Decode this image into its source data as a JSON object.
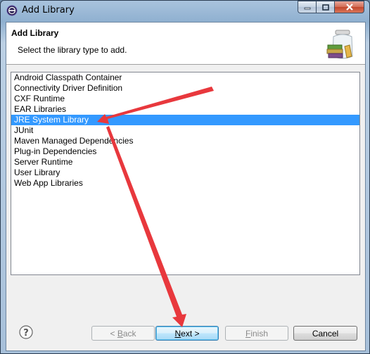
{
  "window": {
    "title": "Add Library",
    "controls": [
      "minimize",
      "maximize",
      "close"
    ]
  },
  "header": {
    "title": "Add Library",
    "description": "Select the library type to add.",
    "icon": "library-jar-icon"
  },
  "library_types": [
    {
      "label": "Android Classpath Container",
      "selected": false
    },
    {
      "label": "Connectivity Driver Definition",
      "selected": false
    },
    {
      "label": "CXF Runtime",
      "selected": false
    },
    {
      "label": "EAR Libraries",
      "selected": false
    },
    {
      "label": "JRE System Library",
      "selected": true
    },
    {
      "label": "JUnit",
      "selected": false
    },
    {
      "label": "Maven Managed Dependencies",
      "selected": false
    },
    {
      "label": "Plug-in Dependencies",
      "selected": false
    },
    {
      "label": "Server Runtime",
      "selected": false
    },
    {
      "label": "User Library",
      "selected": false
    },
    {
      "label": "Web App Libraries",
      "selected": false
    }
  ],
  "buttons": {
    "back": {
      "prefix": "< ",
      "mnemonic": "B",
      "rest": "ack",
      "enabled": false
    },
    "next": {
      "mnemonic": "N",
      "rest": "ext >",
      "enabled": true
    },
    "finish": {
      "mnemonic": "F",
      "rest": "inish",
      "enabled": false
    },
    "cancel": {
      "label": "Cancel",
      "enabled": true
    }
  },
  "help_icon": "question-mark-icon",
  "annotation_color": "#e8383d",
  "selection_color": "#3399ff"
}
